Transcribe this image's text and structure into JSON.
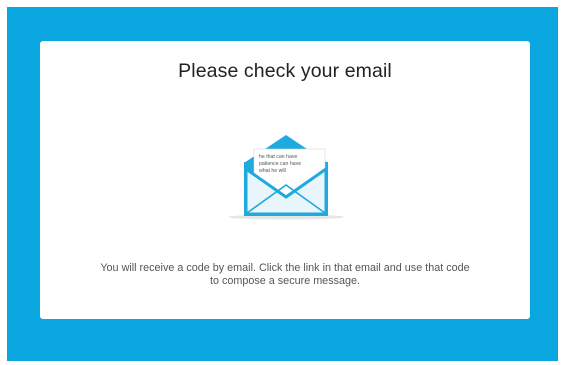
{
  "title": "Please check your email",
  "illustration": {
    "icon": "open-envelope-icon",
    "letter_lines": [
      "he that can have",
      "patience can have",
      "what he will"
    ]
  },
  "message": {
    "line1": "You will receive a code by email. Click the link in that email and use that code",
    "line2": "to compose a secure message."
  },
  "colors": {
    "background_accent": "#0aa6df",
    "card": "#ffffff",
    "envelope": "#1ea9df",
    "envelope_inner": "#e8f6fc"
  }
}
